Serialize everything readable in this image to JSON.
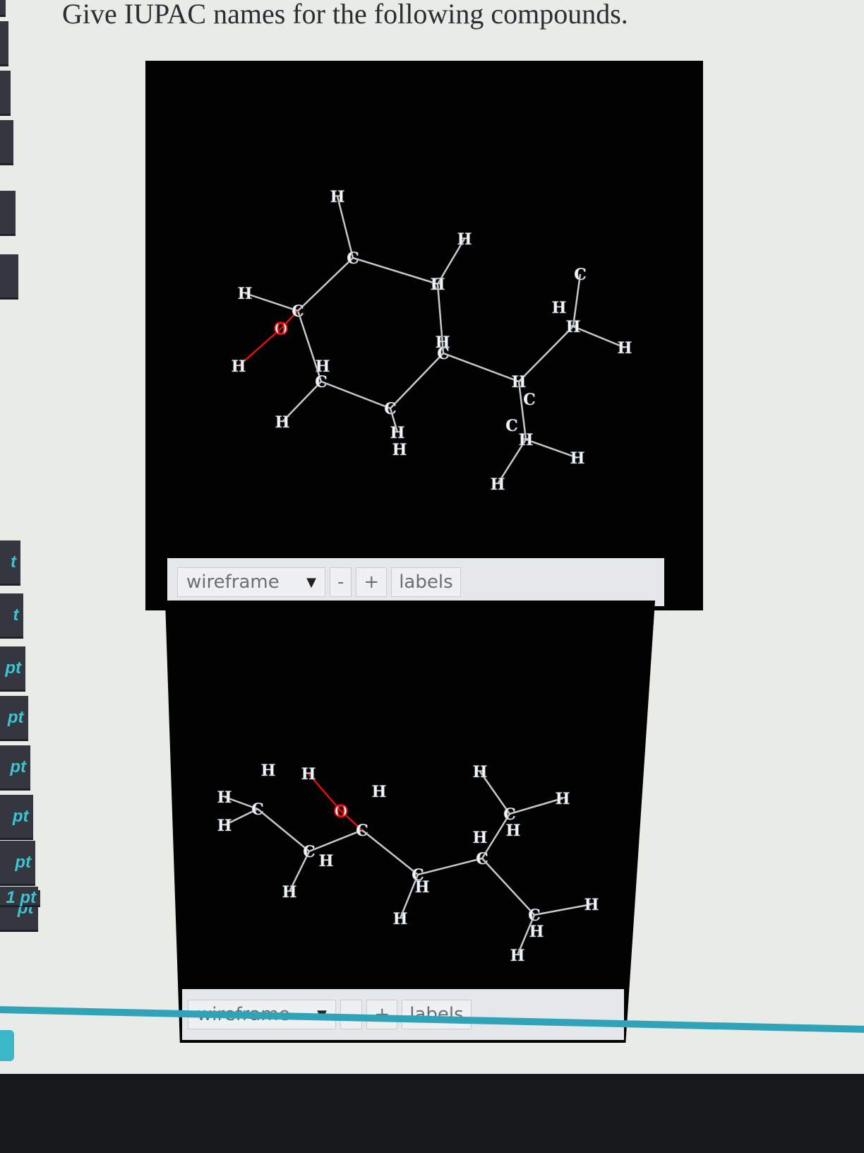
{
  "question": "Give IUPAC names for the following compounds.",
  "sidebar": {
    "items": [
      "",
      "",
      "",
      "",
      "",
      "",
      "t",
      "t",
      "pt",
      "pt",
      "pt",
      "pt",
      "pt",
      "pt",
      "1 pt"
    ]
  },
  "viewers": [
    {
      "style_select": "wireframe",
      "minus_label": "-",
      "plus_label": "+",
      "labels_button": "labels",
      "atoms": [
        "C",
        "C",
        "C",
        "C",
        "C",
        "C",
        "O",
        "H",
        "H",
        "H",
        "H",
        "H",
        "H",
        "H",
        "H",
        "H",
        "H",
        "C",
        "H",
        "C",
        "H",
        "H",
        "H",
        "C",
        "H",
        "H",
        "H"
      ]
    },
    {
      "style_select": "wireframe",
      "minus_label": "-",
      "plus_label": "+",
      "labels_button": "labels",
      "atoms": [
        "C",
        "H",
        "H",
        "H",
        "C",
        "H",
        "H",
        "C",
        "O",
        "H",
        "H",
        "C",
        "H",
        "H",
        "C",
        "H",
        "C",
        "H",
        "H",
        "H",
        "C",
        "H",
        "H",
        "H"
      ]
    }
  ],
  "colors": {
    "accent": "#2fa3b8",
    "oxygen": "#e01010",
    "bond": "#c8c8c8"
  }
}
